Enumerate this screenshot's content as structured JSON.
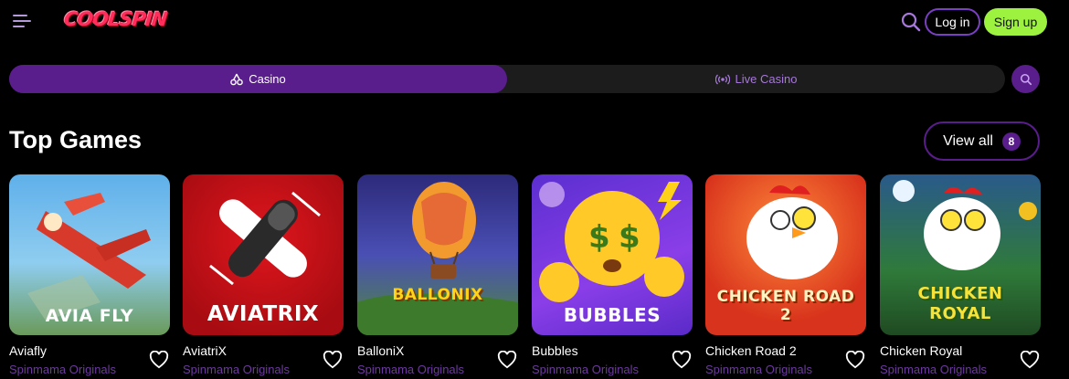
{
  "header": {
    "logo_text": "COOLSPIN",
    "login_label": "Log in",
    "signup_label": "Sign up"
  },
  "tabs": [
    {
      "label": "Casino",
      "icon": "cherry-icon",
      "active": true
    },
    {
      "label": "Live Casino",
      "icon": "broadcast-icon",
      "active": false
    }
  ],
  "section": {
    "title": "Top Games",
    "view_all_label": "View all",
    "view_all_count": "8"
  },
  "games": [
    {
      "name": "Aviafly",
      "provider": "Spinmama Originals",
      "thumb_title": "AVIA FLY",
      "bg": "#5aa6e0"
    },
    {
      "name": "AviatriX",
      "provider": "Spinmama Originals",
      "thumb_title": "AVIATRIX",
      "bg": "#c41218"
    },
    {
      "name": "BalloniX",
      "provider": "Spinmama Originals",
      "thumb_title": "BALLONIX",
      "bg": "#3b3b9a"
    },
    {
      "name": "Bubbles",
      "provider": "Spinmama Originals",
      "thumb_title": "BUBBLES",
      "bg": "#7a3ee0"
    },
    {
      "name": "Chicken Road 2",
      "provider": "Spinmama Originals",
      "thumb_title": "CHICKEN ROAD 2",
      "bg": "#e25a1c"
    },
    {
      "name": "Chicken Royal",
      "provider": "Spinmama Originals",
      "thumb_title": "CHICKEN ROYAL",
      "bg": "#2f7a3a"
    }
  ],
  "colors": {
    "accent": "#5a1d8c",
    "signup": "#9cf23e",
    "provider_text": "#6c3a9c",
    "logo": "#ff2d5a"
  }
}
